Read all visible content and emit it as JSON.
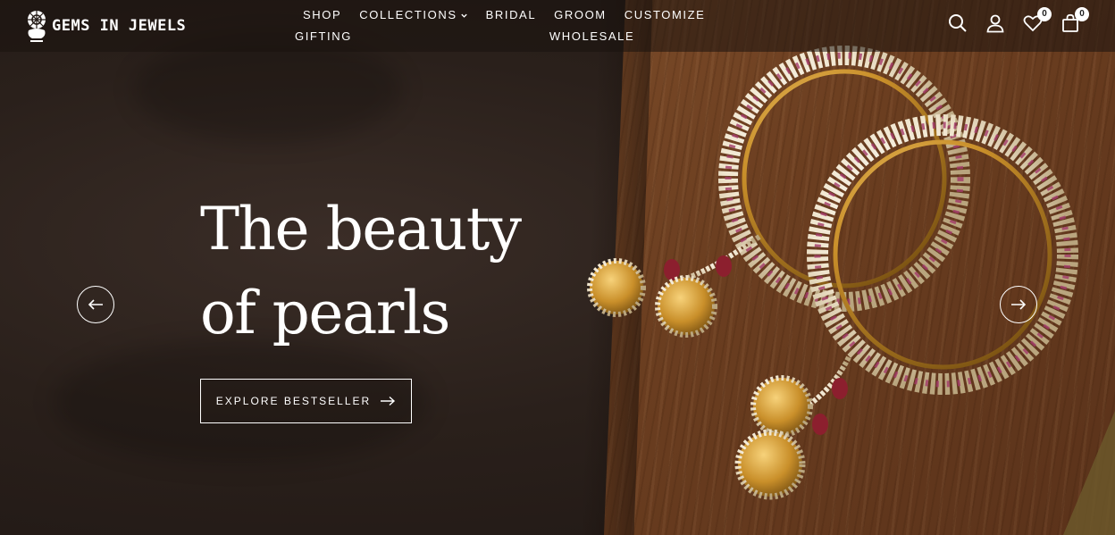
{
  "brand": {
    "name": "GEMS IN JEWELS"
  },
  "nav": {
    "items": [
      {
        "label": "SHOP"
      },
      {
        "label": "COLLECTIONS",
        "icon": "chevron-down-icon"
      },
      {
        "label": "BRIDAL"
      },
      {
        "label": "GROOM"
      },
      {
        "label": "CUSTOMIZE"
      },
      {
        "label": "GIFTING"
      },
      {
        "label": "WHOLESALE"
      }
    ]
  },
  "header_icons": {
    "search": {
      "icon": "search-icon"
    },
    "account": {
      "icon": "user-icon"
    },
    "wishlist": {
      "icon": "heart-icon",
      "count": "0"
    },
    "cart": {
      "icon": "shopping-bag-icon",
      "count": "0"
    }
  },
  "hero": {
    "headline_line1": "The beauty",
    "headline_line2": "of pearls",
    "cta_label": "EXPLORE BESTSELLER",
    "prev_icon": "arrow-left-icon",
    "next_icon": "arrow-right-icon"
  },
  "colors": {
    "text": "#ffffff",
    "wood": "#7a4a28",
    "leather": "#2a201b",
    "gold": "#d4a33c",
    "pearl": "#f3ead6",
    "bead": "#8c1f2e"
  }
}
